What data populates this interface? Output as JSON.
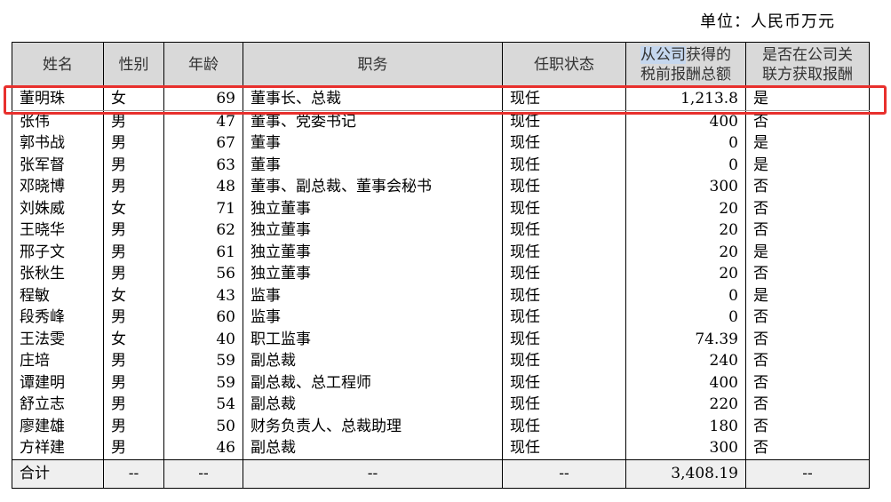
{
  "unit_label": "单位：人民币万元",
  "headers": {
    "name": "姓名",
    "sex": "性别",
    "age": "年龄",
    "position": "职务",
    "status": "任职状态",
    "pay_highlight": "从公司",
    "pay_rest_line1": "获得的",
    "pay_line2": "税前报酬总额",
    "related_line1": "是否在公司关",
    "related_line2": "联方获取报酬"
  },
  "rows": [
    {
      "name": "董明珠",
      "sex": "女",
      "age": "69",
      "position": "董事长、总裁",
      "status": "现任",
      "pay": "1,213.8",
      "related": "是"
    },
    {
      "name": "张伟",
      "sex": "男",
      "age": "47",
      "position": "董事、党委书记",
      "status": "现任",
      "pay": "400",
      "related": "否"
    },
    {
      "name": "郭书战",
      "sex": "男",
      "age": "67",
      "position": "董事",
      "status": "现任",
      "pay": "0",
      "related": "是"
    },
    {
      "name": "张军督",
      "sex": "男",
      "age": "63",
      "position": "董事",
      "status": "现任",
      "pay": "0",
      "related": "是"
    },
    {
      "name": "邓晓博",
      "sex": "男",
      "age": "48",
      "position": "董事、副总裁、董事会秘书",
      "status": "现任",
      "pay": "300",
      "related": "否"
    },
    {
      "name": "刘姝威",
      "sex": "女",
      "age": "71",
      "position": "独立董事",
      "status": "现任",
      "pay": "20",
      "related": "否"
    },
    {
      "name": "王晓华",
      "sex": "男",
      "age": "62",
      "position": "独立董事",
      "status": "现任",
      "pay": "20",
      "related": "否"
    },
    {
      "name": "邢子文",
      "sex": "男",
      "age": "61",
      "position": "独立董事",
      "status": "现任",
      "pay": "20",
      "related": "是"
    },
    {
      "name": "张秋生",
      "sex": "男",
      "age": "56",
      "position": "独立董事",
      "status": "现任",
      "pay": "20",
      "related": "否"
    },
    {
      "name": "程敏",
      "sex": "女",
      "age": "43",
      "position": "监事",
      "status": "现任",
      "pay": "0",
      "related": "是"
    },
    {
      "name": "段秀峰",
      "sex": "男",
      "age": "60",
      "position": "监事",
      "status": "现任",
      "pay": "0",
      "related": "否"
    },
    {
      "name": "王法雯",
      "sex": "女",
      "age": "40",
      "position": "职工监事",
      "status": "现任",
      "pay": "74.39",
      "related": "否"
    },
    {
      "name": "庄培",
      "sex": "男",
      "age": "59",
      "position": "副总裁",
      "status": "现任",
      "pay": "240",
      "related": "否"
    },
    {
      "name": "谭建明",
      "sex": "男",
      "age": "59",
      "position": "副总裁、总工程师",
      "status": "现任",
      "pay": "400",
      "related": "否"
    },
    {
      "name": "舒立志",
      "sex": "男",
      "age": "54",
      "position": "副总裁",
      "status": "现任",
      "pay": "220",
      "related": "否"
    },
    {
      "name": "廖建雄",
      "sex": "男",
      "age": "50",
      "position": "财务负责人、总裁助理",
      "status": "现任",
      "pay": "180",
      "related": "否"
    },
    {
      "name": "方祥建",
      "sex": "男",
      "age": "46",
      "position": "副总裁",
      "status": "现任",
      "pay": "300",
      "related": "否"
    }
  ],
  "total": {
    "label": "合计",
    "sex": "--",
    "age": "--",
    "position": "--",
    "status": "--",
    "pay": "3,408.19",
    "related": "--"
  },
  "colors": {
    "header_bg": "#d9d9d9",
    "highlight_box": "#e8302d",
    "text_highlight": "#c5d7ee"
  }
}
